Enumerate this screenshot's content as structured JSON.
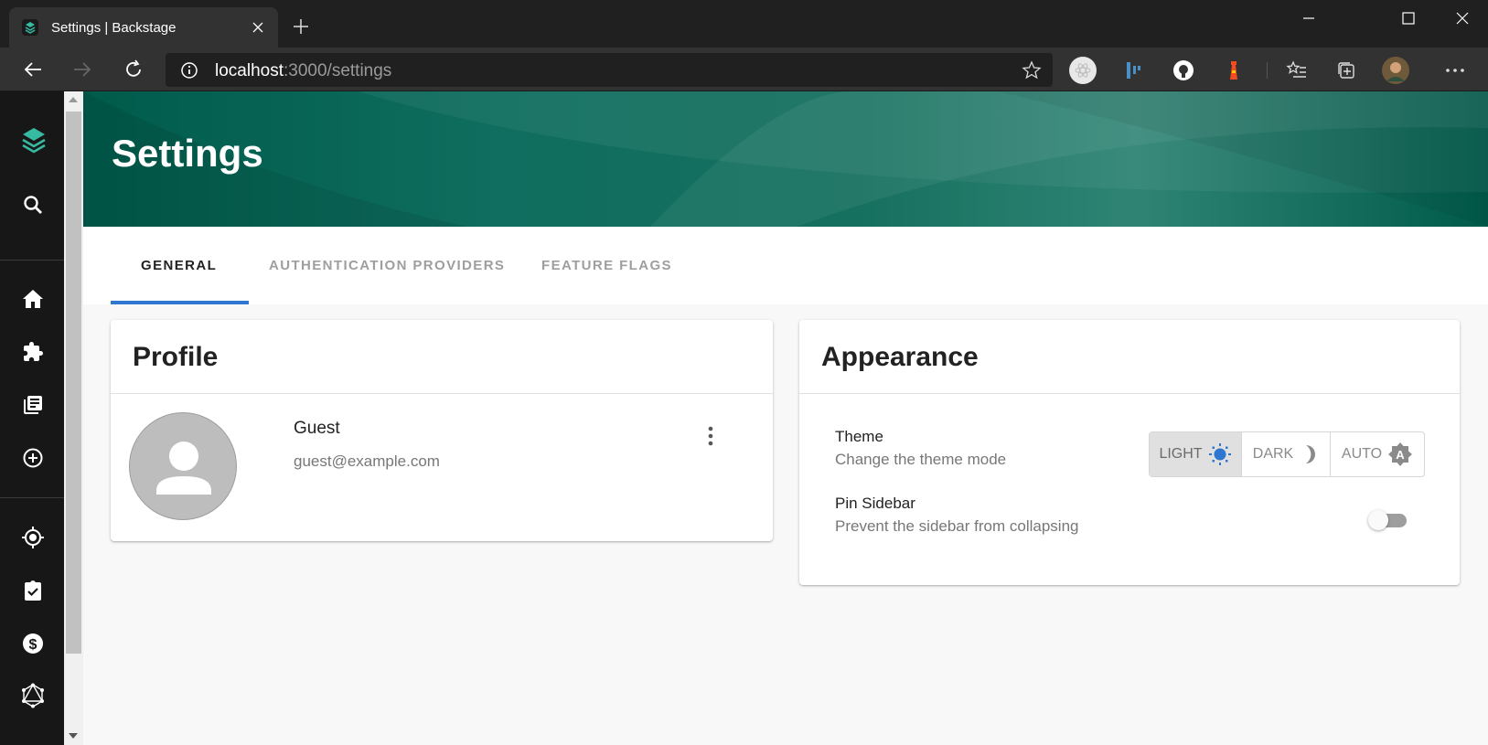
{
  "browser": {
    "tab_title": "Settings | Backstage",
    "url_host": "localhost",
    "url_rest": ":3000/settings"
  },
  "page": {
    "title": "Settings",
    "tabs": [
      {
        "label": "GENERAL",
        "active": true
      },
      {
        "label": "AUTHENTICATION PROVIDERS",
        "active": false
      },
      {
        "label": "FEATURE FLAGS",
        "active": false
      }
    ]
  },
  "sidebar": {
    "items": [
      "logo-icon",
      "search-icon",
      "home-icon",
      "puzzle-icon",
      "library-icon",
      "create-icon",
      "target-icon",
      "checklist-icon",
      "dollar-icon",
      "graphql-icon"
    ]
  },
  "profile": {
    "title": "Profile",
    "name": "Guest",
    "email": "guest@example.com"
  },
  "appearance": {
    "title": "Appearance",
    "theme_label": "Theme",
    "theme_desc": "Change the theme mode",
    "theme_options": [
      {
        "label": "LIGHT",
        "selected": true
      },
      {
        "label": "DARK",
        "selected": false
      },
      {
        "label": "AUTO",
        "selected": false
      }
    ],
    "pin_label": "Pin Sidebar",
    "pin_desc": "Prevent the sidebar from collapsing",
    "pin_enabled": false
  },
  "colors": {
    "header_start": "#005b4b",
    "header_mid": "#2f8474",
    "accent": "#2e77d0",
    "sidebar": "#171717"
  }
}
